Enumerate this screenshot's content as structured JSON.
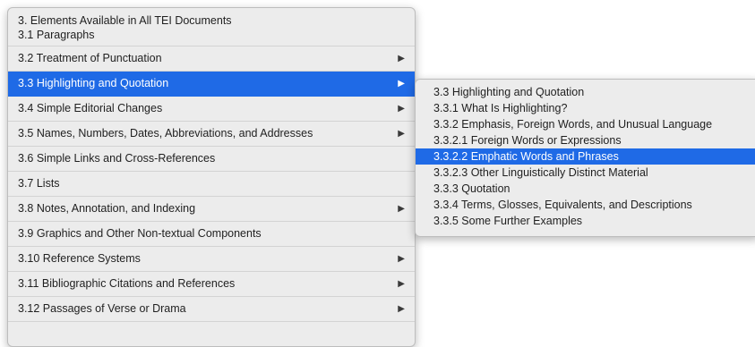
{
  "main_menu": {
    "header_lines": [
      "3. Elements Available in All TEI Documents",
      "3.1 Paragraphs"
    ],
    "items": [
      {
        "label": "3.2 Treatment of Punctuation",
        "has_submenu": true
      },
      {
        "label": "3.3 Highlighting and Quotation",
        "has_submenu": true,
        "selected": true
      },
      {
        "label": "3.4 Simple Editorial Changes",
        "has_submenu": true
      },
      {
        "label": "3.5 Names, Numbers, Dates, Abbreviations, and Addresses",
        "has_submenu": true
      },
      {
        "label": "3.6 Simple Links and Cross-References",
        "has_submenu": false
      },
      {
        "label": "3.7 Lists",
        "has_submenu": false
      },
      {
        "label": "3.8 Notes, Annotation, and Indexing",
        "has_submenu": true
      },
      {
        "label": "3.9 Graphics and Other Non-textual Components",
        "has_submenu": false
      },
      {
        "label": "3.10 Reference Systems",
        "has_submenu": true
      },
      {
        "label": "3.11 Bibliographic Citations and References",
        "has_submenu": true
      },
      {
        "label": "3.12 Passages of Verse or Drama",
        "has_submenu": true
      }
    ]
  },
  "submenu": {
    "items": [
      {
        "label": "3.3 Highlighting and Quotation"
      },
      {
        "label": "3.3.1 What Is Highlighting?"
      },
      {
        "label": "3.3.2 Emphasis, Foreign Words, and Unusual Language"
      },
      {
        "label": "3.3.2.1 Foreign Words or Expressions"
      },
      {
        "label": "3.3.2.2 Emphatic Words and Phrases",
        "selected": true
      },
      {
        "label": "3.3.2.3 Other Linguistically Distinct Material"
      },
      {
        "label": "3.3.3 Quotation"
      },
      {
        "label": "3.3.4 Terms, Glosses, Equivalents, and Descriptions"
      },
      {
        "label": "3.3.5 Some Further Examples"
      }
    ]
  },
  "icons": {
    "submenu_arrow": "chevron-right-icon",
    "arrow_glyph": "▶"
  },
  "colors": {
    "selection": "#1f6ae6",
    "menu_background": "#ececec"
  }
}
